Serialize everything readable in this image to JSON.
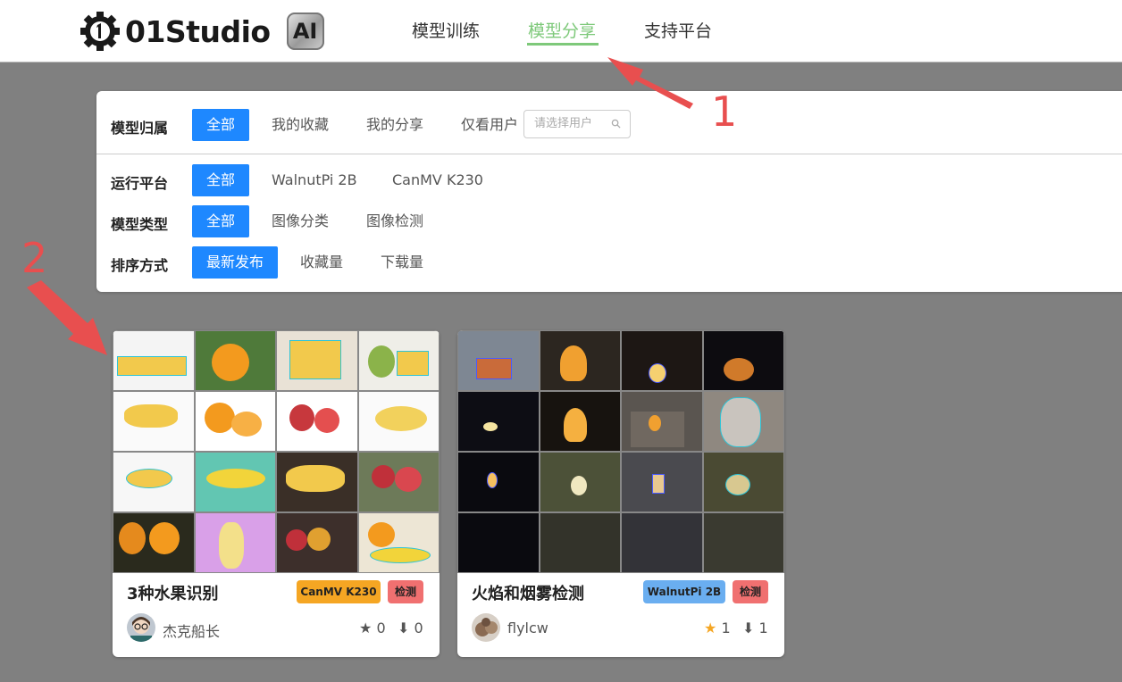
{
  "brand": {
    "name": "01Studio",
    "ai_badge": "AI"
  },
  "nav": [
    {
      "label": "模型训练",
      "active": false
    },
    {
      "label": "模型分享",
      "active": true
    },
    {
      "label": "支持平台",
      "active": false
    }
  ],
  "annotations": {
    "one": "1",
    "two": "2"
  },
  "filters": {
    "owner": {
      "label": "模型归属",
      "options": [
        "全部",
        "我的收藏",
        "我的分享"
      ],
      "user_only": "仅看用户",
      "user_placeholder": "请选择用户"
    },
    "platform": {
      "label": "运行平台",
      "options": [
        "全部",
        "WalnutPi 2B",
        "CanMV K230"
      ]
    },
    "type": {
      "label": "模型类型",
      "options": [
        "全部",
        "图像分类",
        "图像检测"
      ]
    },
    "sort": {
      "label": "排序方式",
      "options": [
        "最新发布",
        "收藏量",
        "下载量"
      ]
    }
  },
  "cards": [
    {
      "title": "3种水果识别",
      "platform_tag": "CanMV K230",
      "type_tag": "检测",
      "author": "杰克船长",
      "stars": "0",
      "downloads": "0",
      "starred": false
    },
    {
      "title": "火焰和烟雾检测",
      "platform_tag": "WalnutPi 2B",
      "type_tag": "检测",
      "author": "flylcw",
      "stars": "1",
      "downloads": "1",
      "starred": true
    }
  ],
  "colors": {
    "accent": "#1e88ff",
    "nav_active": "#7ec97a",
    "tag_k230": "#f5a623",
    "tag_walnut": "#6aaef0",
    "tag_detect": "#f07070",
    "annotation": "#e84f4f"
  }
}
